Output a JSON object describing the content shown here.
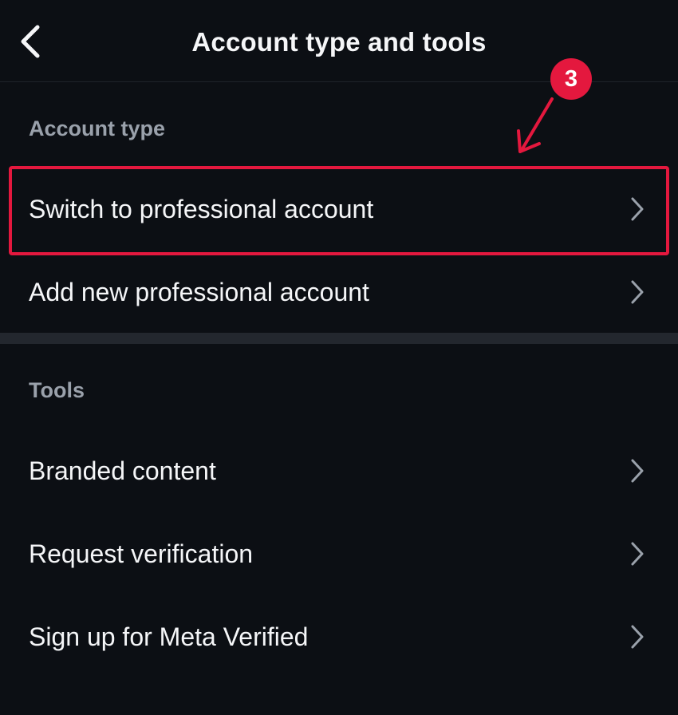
{
  "header": {
    "title": "Account type and tools",
    "back_icon": "chevron-left-icon"
  },
  "sections": {
    "account_type": {
      "label": "Account type",
      "items": [
        {
          "label": "Switch to professional account",
          "icon": "chevron-right-icon"
        },
        {
          "label": "Add new professional account",
          "icon": "chevron-right-icon"
        }
      ]
    },
    "tools": {
      "label": "Tools",
      "items": [
        {
          "label": "Branded content",
          "icon": "chevron-right-icon"
        },
        {
          "label": "Request verification",
          "icon": "chevron-right-icon"
        },
        {
          "label": "Sign up for Meta Verified",
          "icon": "chevron-right-icon"
        }
      ]
    }
  },
  "annotation": {
    "step_number": "3",
    "color": "#e4183e"
  },
  "colors": {
    "background": "#0c0f14",
    "text_primary": "#f5f6f8",
    "text_secondary": "#9aa1ab",
    "divider": "#23272e",
    "chevron": "#9aa1ab"
  }
}
